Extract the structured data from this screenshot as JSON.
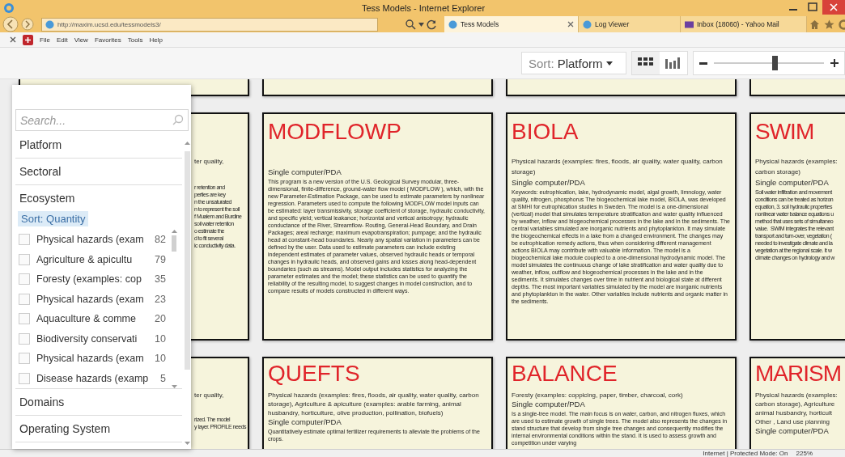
{
  "window": {
    "title": "Tess Models - Internet Explorer"
  },
  "browser": {
    "address": "http://maxim.ucsd.edu/tessmodels3/",
    "tabs": [
      {
        "label": "Tess Models",
        "selected": true
      },
      {
        "label": "Log Viewer",
        "selected": false
      },
      {
        "label": "Inbox (18060) - Yahoo Mail",
        "selected": false
      }
    ]
  },
  "menu": [
    "File",
    "Edit",
    "View",
    "Favorites",
    "Tools",
    "Help"
  ],
  "toolbar": {
    "sort_label": "Sort:",
    "sort_value": "Platform",
    "view_modes": [
      {
        "kind": "grid",
        "selected": true
      },
      {
        "kind": "bars",
        "selected": false
      }
    ],
    "zoom": {
      "level": 0.55
    }
  },
  "filter_panel": {
    "search": {
      "placeholder": "Search..."
    },
    "facets": [
      {
        "label": "Platform"
      },
      {
        "label": "Sectoral"
      },
      {
        "label": "Ecosystem",
        "sort": "Sort: Quantity",
        "options": [
          {
            "label": "Physical hazards (exam",
            "count": "82",
            "checked": false
          },
          {
            "label": "Agriculture & apicultu",
            "count": "79",
            "checked": false
          },
          {
            "label": "Foresty (examples: cop",
            "count": "35",
            "checked": false
          },
          {
            "label": "Physical hazards (exam",
            "count": "23",
            "checked": false
          },
          {
            "label": "Aquaculture & comme",
            "count": "20",
            "checked": false
          },
          {
            "label": "Biodiversity conservati",
            "count": "10",
            "checked": false
          },
          {
            "label": "Physical hazards (exam",
            "count": "10",
            "checked": false
          },
          {
            "label": "Disease hazards (examp",
            "count": "5",
            "checked": false
          }
        ]
      },
      {
        "label": "Domains"
      },
      {
        "label": "Operating System"
      }
    ]
  },
  "card_rows": [
    [
      {
        "kind": "covered",
        "category_lines": [
          "ter quality,"
        ],
        "description_lines": [
          "r retention and",
          "perties are key",
          "n the unsaturated",
          "n to represent the soil",
          "f Mualem and Burdine",
          "soil water retention",
          "o estimate the",
          "d to fit several",
          "ic conductivity data."
        ]
      },
      {
        "kind": "full",
        "title": "MODFLOWP",
        "platform": "Single computer/PDA",
        "description": "This program is a new version of the U.S. Geological Survey modular, three-dimensional, finite-difference, ground-water flow model ( MODFLOW ), which, with the new Parameter-Estimation Package, can be used to estimate parameters by nonlinear regression. Parameters used to compute the following MODFLOW model inputs can be estimated: layer transmissivity, storage coefficient of storage, hydraulic conductivity, and specific yield; vertical leakance; horizontal and vertical anisotropy; hydraulic conductance of the River, Streamflow- Routing, General-Head Boundary, and Drain Packages; areal recharge; maximum evapotranspiration; pumpage; and the hydraulic head at constant-head boundaries. Nearly any spatial variation in parameters can be defined by the user. Data used to estimate parameters can include existing independent estimates of parameter values, observed hydraulic heads or temporal changes in hydraulic heads, and observed gains and losses along head-dependent boundaries (such as streams). Model output includes statistics for analyzing the parameter estimates and the model; these statistics can be used to quantify the reliability of the resulting model, to suggest changes in model construction, and to compare results of models constructed in different ways."
      },
      {
        "kind": "full",
        "title": "BIOLA",
        "category": "Physical hazards (examples: fires, floods, air quality, water quality, carbon storage)",
        "platform": "Single computer/PDA",
        "description": "Keywords: eutrophication, lake, hydrodynamic model, algal growth, limnology, water quality, nitrogen, phosphorus   The biogeochemical lake model, BIOLA, was developed at SMHI for eutrophication studies in Sweden. The model is a one-dimensional (vertical) model that simulates temperature stratification and water quality influenced by weather, inflow and biogeochemical processes in the lake and in the sediments. The central variables simulated are inorganic nutrients and phytoplankton. It may simulate the biogeochemical effects in a lake from a changed environment. The changes may be eutrophication remedy actions, thus when considering different management actions BIOLA may contribute with valuable information. The model is a biogeochemical lake module coupled to a one-dimensional hydrodynamic model. The model simulates the continuous change of lake stratification and water quality due to weather, inflow, outflow and biogeochemical processes in the lake and in the sediments. It simulates changes over time in nutrient and biological state at different depths. The most important variables simulated by the model are inorganic nutrients and phytoplankton in the water. Other variables include nutrients and organic matter in the sediments."
      },
      {
        "kind": "edge",
        "title": "SWIM",
        "category_lines": [
          "Physical hazards (examples:",
          "carbon storage)"
        ],
        "platform": "Single computer/PDA",
        "description_lines": [
          "Soil water infiltration and movement",
          "conditions can be treated as horizon",
          "equation, 3. soil hydraulic properties",
          "nonlinear water balance equations u",
          "method that uses sets of simultaneo",
          "value.  SWIM integrates the relevant",
          "transport and turn-over, vegetation (",
          "needed to investigate climate and la",
          "vegetation at the regional scale. It w",
          "climate changes on hydrology and w"
        ]
      }
    ],
    [
      {
        "kind": "covered",
        "category_lines": [
          "ter quality,"
        ],
        "description_lines": [
          "rized. The model",
          "y layer. PROFILE needs"
        ]
      },
      {
        "kind": "full",
        "title": "QUEFTS",
        "category": "Physical hazards (examples: fires, floods, air quality, water quality, carbon storage), Agriculture & apiculture (examples: arable farming, animal husbandry, horticulture, olive production, pollination, biofuels)",
        "platform": "Single computer/PDA",
        "description": "Quantitatively estimate optimal fertilizer requirements to alleviate the problems of the crops."
      },
      {
        "kind": "full",
        "title": "BALANCE",
        "category": "Foresty (examples: coppicing, paper, timber, charcoal, cork)",
        "platform": "Single computer/PDA",
        "description": "Is a single-tree model. The main focus is on water, carbon, and nitrogen fluxes, which are used to estimate growth of single trees. The model also represents the changes in stand structure that develop from single tree changes and consequently modifies the internal environmental conditions within the stand. It is used to assess growth and competition under varying"
      },
      {
        "kind": "edge",
        "title": "MARISM",
        "category_lines": [
          "Physical hazards (examples:",
          "carbon storage), Agriculture",
          "animal husbandry, horticult",
          "Other , Land use planning"
        ],
        "platform": "Single computer/PDA"
      }
    ]
  ],
  "status_bar": {
    "zone": "Internet | Protected Mode: On",
    "zoom": "225%"
  }
}
